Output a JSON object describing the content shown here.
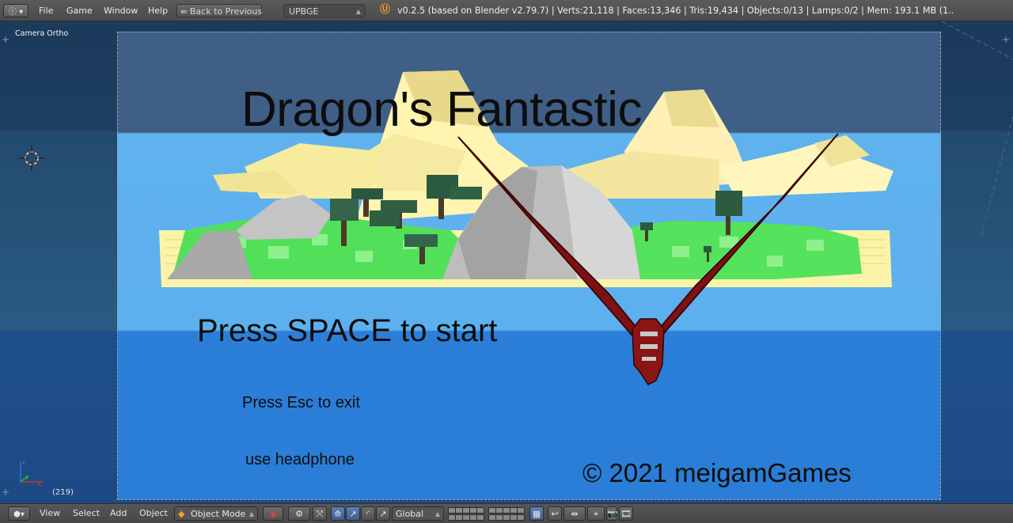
{
  "topbar": {
    "editor_icon": "info-icon",
    "menus": [
      "File",
      "Game",
      "Window",
      "Help"
    ],
    "back_button": "Back to Previous",
    "engine": "UPBGE",
    "stats": "v0.2.5 (based on Blender v2.79.7)  | Verts:21,118 | Faces:13,346 | Tris:19,434 | Objects:0/13 | Lamps:0/2 | Mem: 193.1 MB (1.."
  },
  "viewport": {
    "camera_label": "Camera Ortho",
    "frame_number": "(219)"
  },
  "game": {
    "title": "Dragon's Fantastic",
    "start_prompt": "Press SPACE to start",
    "exit_prompt": "Press Esc to exit",
    "hint": "use headphone",
    "copyright": "© 2021 meigamGames"
  },
  "bottombar": {
    "menus": [
      "View",
      "Select",
      "Add",
      "Object"
    ],
    "mode": "Object Mode",
    "orientation": "Global"
  },
  "colors": {
    "header_bg": "#4f4f4f",
    "sky": "#5db0ee",
    "water": "#2a7ed7",
    "title_band": "#3f5f86",
    "grass": "#52e05a",
    "sand": "#fbf3a8",
    "rock": "#b8b8b8",
    "dragon": "#8b1414",
    "accent": "#f0a22a"
  }
}
